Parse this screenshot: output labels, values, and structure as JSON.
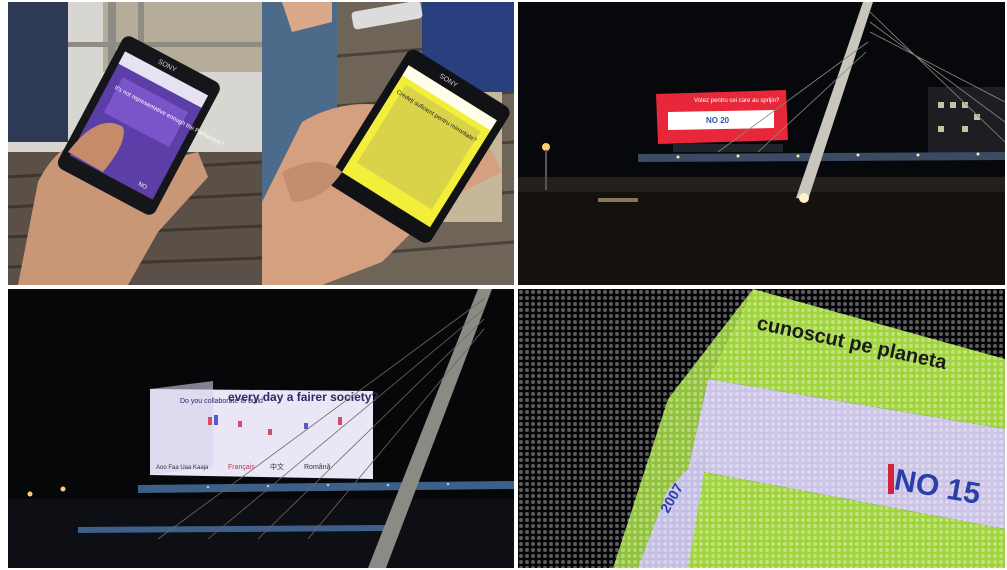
{
  "photos": {
    "phone_purple": {
      "brand": "SONY",
      "screen_question": "It's not representative enough the Parliament?",
      "footer": "NO"
    },
    "phone_yellow": {
      "brand": "SONY",
      "screen_question": "Credeți suficient pentru minoritate?"
    },
    "billboard_night": {
      "banner_top": "Votez pentru cei care au sprijin?",
      "banner_label": "NO 20"
    },
    "cube_bridge": {
      "question": "every day a fairer society?",
      "question_prefix": "Do you collaborate to build",
      "legend_1": "Français",
      "legend_2": "中文",
      "legend_3": "Română",
      "axis_labels": "Aoo  Faa  Uaa  Kaaja"
    },
    "led_closeup": {
      "top_text": "cunoscut pe planeta",
      "big_label": "NO 15",
      "side_text": "2007"
    }
  }
}
